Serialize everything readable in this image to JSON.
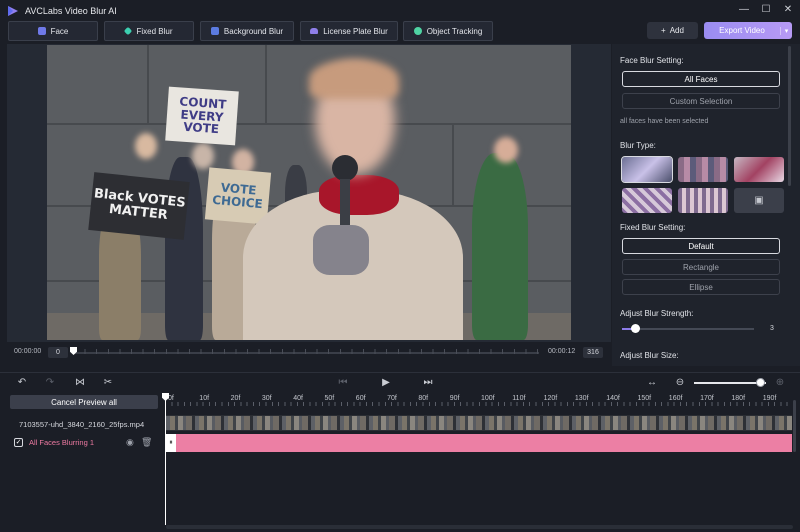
{
  "app": {
    "title": "AVCLabs Video Blur AI",
    "window_controls": {
      "minimize": "—",
      "maximize": "☐",
      "close": "✕"
    }
  },
  "modes": [
    {
      "label": "Face",
      "icon": "face-icon",
      "color": "#6f79e8"
    },
    {
      "label": "Fixed Blur",
      "icon": "fixed-blur-icon",
      "color": "#3ccfb0"
    },
    {
      "label": "Background Blur",
      "icon": "background-blur-icon",
      "color": "#5b7be0"
    },
    {
      "label": "License Plate Blur",
      "icon": "car-icon",
      "color": "#8e7ee8"
    },
    {
      "label": "Object Tracking",
      "icon": "object-tracking-icon",
      "color": "#4fd3a3"
    }
  ],
  "header_actions": {
    "add_label": "Add",
    "add_icon": "+",
    "export_label": "Export Video",
    "export_dropdown": "▾"
  },
  "scene_text": {
    "sign1": "COUNT\nEVERY\nVOTE",
    "sign2": "Black VOTES\nMATTER",
    "sign3": "VOTE\nCHOICE"
  },
  "playback": {
    "current_time": "00:00:00",
    "current_frame": "0",
    "end_time": "00:00:12",
    "end_frame": "316"
  },
  "settings": {
    "face_blur_label": "Face Blur Setting:",
    "all_faces": "All Faces",
    "custom_selection": "Custom Selection",
    "all_faces_note": "all faces have been selected",
    "blur_type_label": "Blur Type:",
    "fixed_blur_label": "Fixed Blur Setting:",
    "default_label": "Default",
    "rectangle_label": "Rectangle",
    "ellipse_label": "Ellipse",
    "strength_label": "Adjust Blur Strength:",
    "strength_value": "3",
    "strength_fraction": 0.1,
    "size_label": "Adjust Blur Size:"
  },
  "timeline_toolbar": {
    "undo": "↶",
    "redo": "↷",
    "split": "⋈",
    "cut": "✂",
    "prev_frame": "⏮",
    "play": "▶",
    "next_frame": "⏭",
    "fit": "↔",
    "zoom_out": "⊖",
    "zoom_in": "⊕",
    "zoom_fraction": 0.92
  },
  "tracks": {
    "cancel_preview": "Cancel Preview all",
    "file_name": "7103557-uhd_3840_2160_25fps.mp4",
    "blur_track_name": "All Faces Blurring 1",
    "blur_track_checked": "✓",
    "eye_icon": "◉",
    "trash_icon": "🗑",
    "blur_start_marker": "⏸"
  },
  "ruler": [
    "0f",
    "10f",
    "20f",
    "30f",
    "40f",
    "50f",
    "60f",
    "70f",
    "80f",
    "90f",
    "100f",
    "110f",
    "120f",
    "130f",
    "140f",
    "150f",
    "160f",
    "170f",
    "180f",
    "190f"
  ]
}
